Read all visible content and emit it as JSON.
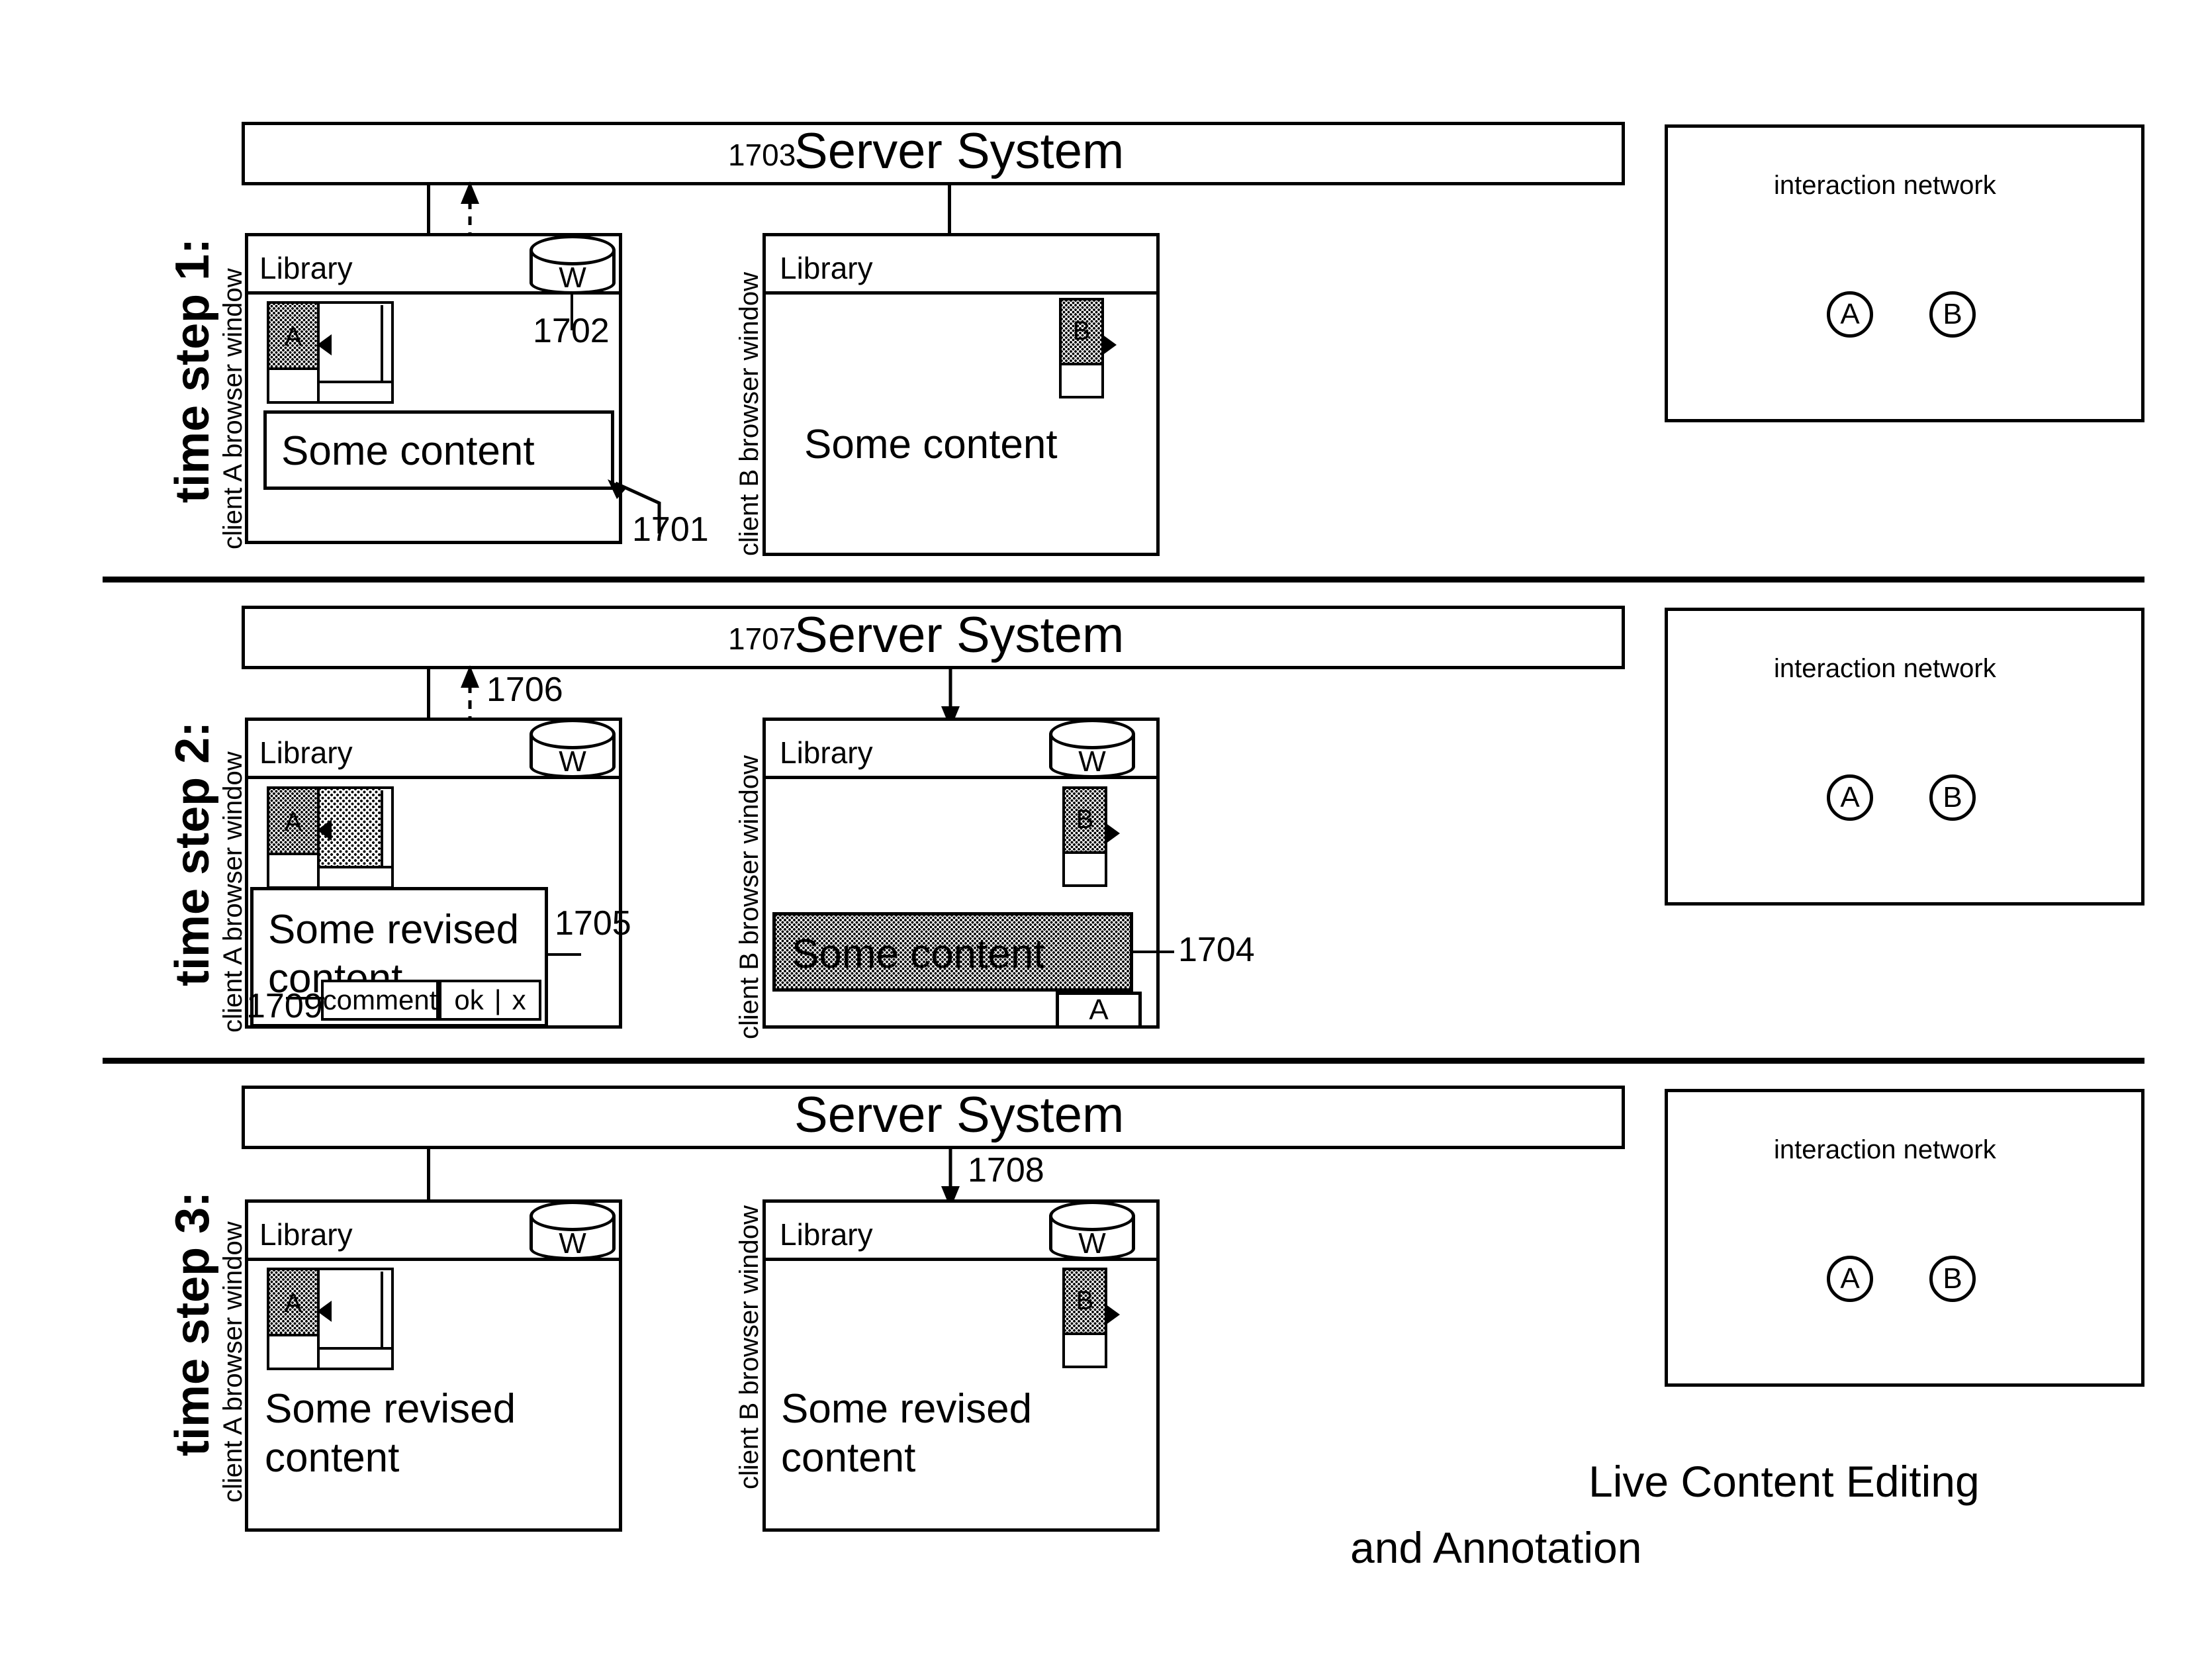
{
  "figure": {
    "caption_line1": "Live Content Editing",
    "caption_line2": "and Annotation"
  },
  "steps": [
    {
      "step_label": "time step 1:",
      "server": {
        "ref": "1703",
        "title": "Server System"
      },
      "client_a": {
        "window_label": "client A browser window",
        "library_label": "Library",
        "storage_letter": "W",
        "thumbnail_letter": "A",
        "content_text": "Some content",
        "refs": [
          {
            "id": "1702",
            "target": "library-storage"
          },
          {
            "id": "1701",
            "target": "content-box"
          }
        ]
      },
      "client_b": {
        "window_label": "client B browser window",
        "library_label": "Library",
        "thumbnail_letter": "B",
        "content_text": "Some content"
      },
      "interaction_network": {
        "title": "interaction network",
        "nodes": [
          "A",
          "B"
        ]
      }
    },
    {
      "step_label": "time step 2:",
      "server": {
        "ref": "1707",
        "title": "Server System"
      },
      "client_a": {
        "window_label": "client A browser window",
        "library_label": "Library",
        "storage_letter": "W",
        "thumbnail_letter": "A",
        "content_line1": "Some revised",
        "content_line2": "content",
        "toolbar": {
          "comment_label": "comment",
          "ok_label": "ok",
          "separator": "|",
          "close_label": "x"
        },
        "refs": [
          {
            "id": "1706",
            "target": "upload-arrow"
          },
          {
            "id": "1705",
            "target": "edit-box"
          },
          {
            "id": "1709",
            "target": "comment-toolbar"
          }
        ]
      },
      "client_b": {
        "window_label": "client B browser window",
        "library_label": "Library",
        "storage_letter": "W",
        "thumbnail_letter": "B",
        "content_text": "Some content",
        "annotation_tag": "A",
        "refs": [
          {
            "id": "1704",
            "target": "highlighted-content"
          }
        ]
      },
      "interaction_network": {
        "title": "interaction network",
        "nodes": [
          "A",
          "B"
        ]
      }
    },
    {
      "step_label": "time step 3:",
      "server": {
        "ref": "",
        "title": "Server System"
      },
      "client_a": {
        "window_label": "client A browser window",
        "library_label": "Library",
        "storage_letter": "W",
        "thumbnail_letter": "A",
        "content_line1": "Some revised",
        "content_line2": "content"
      },
      "client_b": {
        "window_label": "client B browser window",
        "library_label": "Library",
        "storage_letter": "W",
        "thumbnail_letter": "B",
        "content_line1": "Some revised",
        "content_line2": "content",
        "refs": [
          {
            "id": "1708",
            "target": "download-arrow"
          }
        ]
      },
      "interaction_network": {
        "title": "interaction network",
        "nodes": [
          "A",
          "B"
        ]
      }
    }
  ]
}
